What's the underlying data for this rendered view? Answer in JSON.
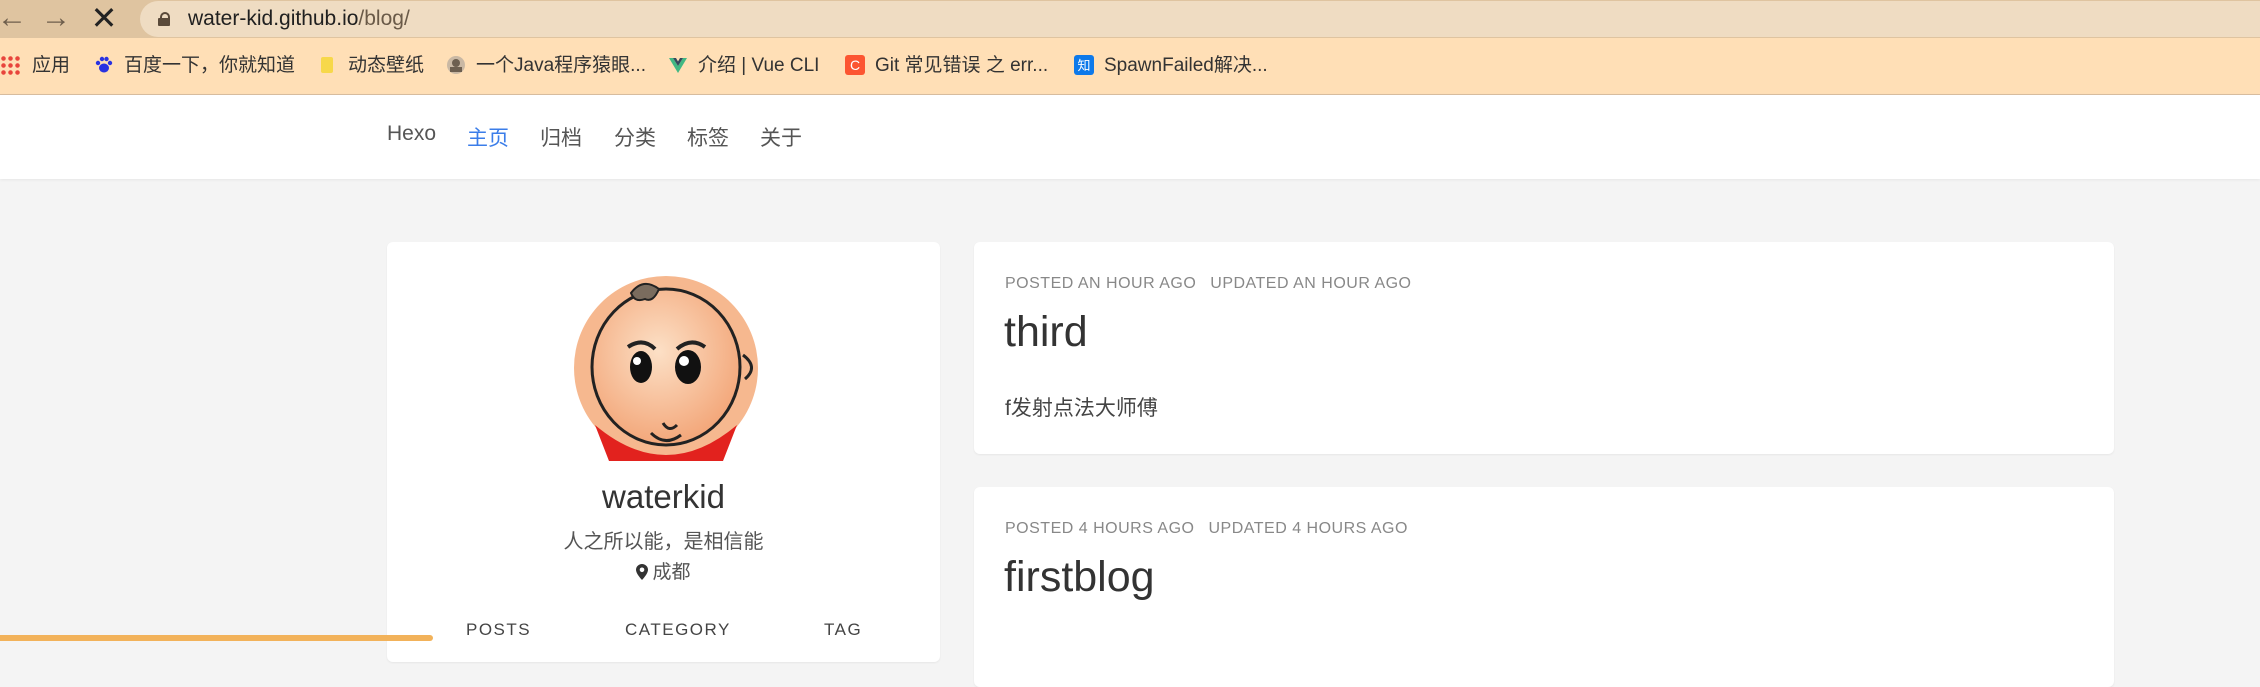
{
  "browser": {
    "url_host": "water-kid.github.io",
    "url_path": "/blog/",
    "bookmarks": [
      {
        "label": "应用",
        "icon": "apps-grid-icon"
      },
      {
        "label": "百度一下，你就知道",
        "icon": "baidu-paw-icon"
      },
      {
        "label": "动态壁纸",
        "icon": "folder-icon"
      },
      {
        "label": "一个Java程序猿眼...",
        "icon": "avatar-favicon-icon"
      },
      {
        "label": "介绍 | Vue CLI",
        "icon": "vue-logo-icon"
      },
      {
        "label": "Git 常见错误 之 err...",
        "icon": "csdn-c-icon"
      },
      {
        "label": "SpawnFailed解决...",
        "icon": "zhihu-icon"
      }
    ]
  },
  "site": {
    "brand": "Hexo",
    "nav": [
      "主页",
      "归档",
      "分类",
      "标签",
      "关于"
    ],
    "active_nav": "主页"
  },
  "profile": {
    "name": "waterkid",
    "bio": "人之所以能，是相信能",
    "location": "成都",
    "stats": [
      "POSTS",
      "CATEGORY",
      "TAG"
    ]
  },
  "posts": [
    {
      "posted": "POSTED AN HOUR AGO",
      "updated": "UPDATED AN HOUR AGO",
      "title": "third",
      "excerpt": "f发射点法大师傅"
    },
    {
      "posted": "POSTED 4 HOURS AGO",
      "updated": "UPDATED 4 HOURS AGO",
      "title": "firstblog",
      "excerpt": ""
    }
  ],
  "colors": {
    "accent": "#3b7de9",
    "toolbar": "#dfc4a0",
    "bookmarks_bar": "#ffdfb6",
    "progress": "#f2b25a"
  }
}
